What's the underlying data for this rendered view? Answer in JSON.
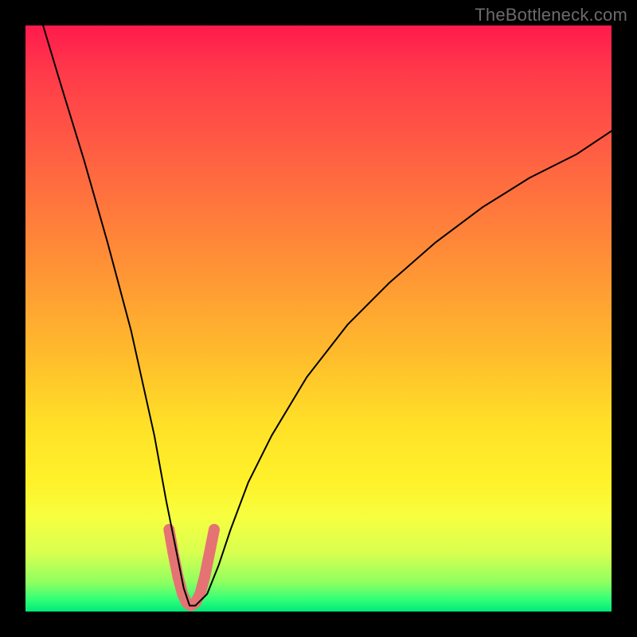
{
  "attribution": "TheBottleneck.com",
  "chart_data": {
    "type": "line",
    "title": "",
    "xlabel": "",
    "ylabel": "",
    "xlim": [
      0,
      100
    ],
    "ylim": [
      0,
      100
    ],
    "grid": false,
    "legend": false,
    "annotations": [],
    "series": [
      {
        "name": "main-curve",
        "color": "#000000",
        "stroke_width": 2,
        "x": [
          3,
          6,
          10,
          14,
          18,
          22,
          24,
          26,
          27,
          28,
          29,
          31,
          33,
          35,
          38,
          42,
          48,
          55,
          62,
          70,
          78,
          86,
          94,
          100
        ],
        "values": [
          100,
          90,
          77,
          63,
          48,
          30,
          19,
          9,
          4,
          1,
          1,
          3,
          8,
          14,
          22,
          30,
          40,
          49,
          56,
          63,
          69,
          74,
          78,
          82
        ]
      },
      {
        "name": "valley-highlight",
        "color": "#e57373",
        "stroke_width": 14,
        "x": [
          24.5,
          25.2,
          26.0,
          26.8,
          27.5,
          28.2,
          29.0,
          29.8,
          30.6,
          31.4,
          32.2
        ],
        "values": [
          14,
          10,
          6,
          3,
          1.5,
          1,
          1.5,
          3,
          6,
          10,
          14
        ]
      }
    ]
  }
}
